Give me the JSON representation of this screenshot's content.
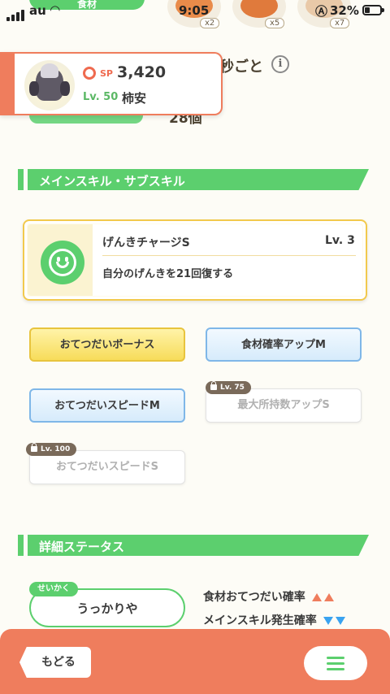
{
  "status_bar": {
    "carrier": "au",
    "time": "9:05",
    "battery_pct": "32%",
    "battery_level": 0.32
  },
  "header": {
    "top_chip": "食材",
    "ingredients": [
      {
        "count": "x2",
        "color": "#e98b4a"
      },
      {
        "count": "x5",
        "color": "#e07a3c"
      },
      {
        "count": "x7",
        "color": "#e9c9a8"
      }
    ],
    "bg_label": "秒ごと",
    "bg_count": "28個"
  },
  "pokemon_card": {
    "sp_label": "SP",
    "sp_value": "3,420",
    "level": "Lv. 50",
    "nickname": "柿安"
  },
  "sections": {
    "skills_title": "メインスキル・サブスキル",
    "details_title": "詳細ステータス"
  },
  "main_skill": {
    "name": "げんきチャージS",
    "level": "Lv. 3",
    "description": "自分のげんきを21回復する"
  },
  "sub_skills": [
    {
      "label": "おてつだいボーナス",
      "style": "gold",
      "lock": ""
    },
    {
      "label": "食材確率アップM",
      "style": "blue",
      "lock": ""
    },
    {
      "label": "おてつだいスピードM",
      "style": "blue",
      "lock": ""
    },
    {
      "label": "最大所持数アップS",
      "style": "locked",
      "lock": "Lv. 75"
    },
    {
      "label": "おてつだいスピードS",
      "style": "locked",
      "lock": "Lv. 100"
    }
  ],
  "nature": {
    "tag": "せいかく",
    "value": "うっかりや",
    "up_stat": "食材おてつだい確率",
    "down_stat": "メインスキル発生確率"
  },
  "nav": {
    "back_label": "もどる",
    "menu_icon": "hamburger-menu-icon"
  },
  "colors": {
    "accent_green": "#5ccf6e",
    "accent_orange": "#ef7d5d",
    "gold": "#f2c94c",
    "blue": "#7fb7e8"
  }
}
